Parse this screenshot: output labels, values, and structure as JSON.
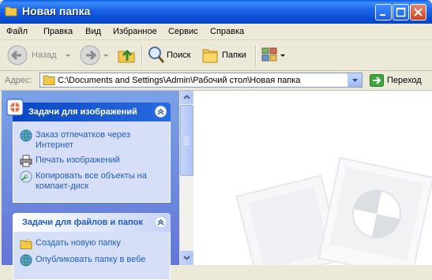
{
  "window": {
    "title": "Новая папка",
    "buttons": {
      "minimize": "minimize-icon",
      "maximize": "maximize-icon",
      "close": "close-icon"
    }
  },
  "menu": [
    "Файл",
    "Правка",
    "Вид",
    "Избранное",
    "Сервис",
    "Справка"
  ],
  "toolbar": {
    "back_label": "Назад",
    "search_label": "Поиск",
    "folders_label": "Папки"
  },
  "address": {
    "label": "Адрес:",
    "value": "C:\\Documents and Settings\\Admin\\Рабочий стол\\Новая папка",
    "go_label": "Переход"
  },
  "tasks": {
    "image_tasks": {
      "title": "Задачи для изображений",
      "items": [
        "Заказ отпечатков через Интернет",
        "Печать изображений",
        "Копировать все объекты на компакт-диск"
      ]
    },
    "file_tasks": {
      "title": "Задачи для файлов и папок",
      "items": [
        "Создать новую папку",
        "Опубликовать папку в вебе"
      ]
    }
  },
  "colors": {
    "titlebar": "#0A4FD6",
    "taskpane": "#6F8FDF",
    "link": "#215DC6",
    "panel_title": "#215DC6"
  }
}
